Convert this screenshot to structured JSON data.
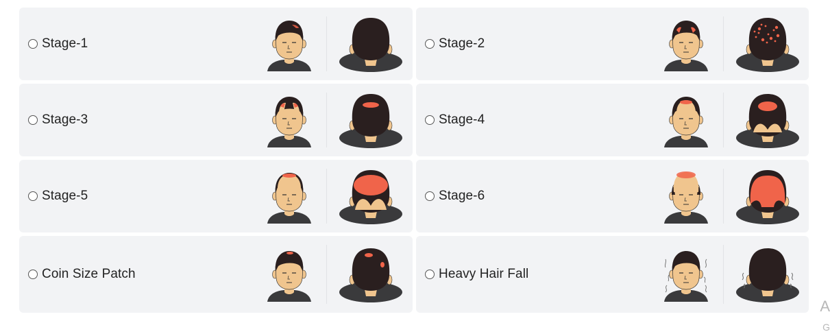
{
  "options": [
    {
      "label": "Stage-1",
      "face_bald": "none",
      "back_bald": "none"
    },
    {
      "label": "Stage-2",
      "face_bald": "temples",
      "back_bald": "speckle"
    },
    {
      "label": "Stage-3",
      "face_bald": "temples-deep",
      "back_bald": "small"
    },
    {
      "label": "Stage-4",
      "face_bald": "front",
      "back_bald": "medium"
    },
    {
      "label": "Stage-5",
      "face_bald": "front-wide",
      "back_bald": "large"
    },
    {
      "label": "Stage-6",
      "face_bald": "full",
      "back_bald": "xlarge"
    },
    {
      "label": "Coin Size Patch",
      "face_bald": "spot",
      "back_bald": "coin"
    },
    {
      "label": "Heavy Hair Fall",
      "face_bald": "fall",
      "back_bald": "fall"
    }
  ],
  "corner_text": {
    "a": "A",
    "g": "G"
  },
  "colors": {
    "hair": "#2a1f1f",
    "skin": "#f0c58e",
    "bald": "#f0644a",
    "shirt": "#3a3a3c",
    "card_bg": "#f2f3f5"
  }
}
